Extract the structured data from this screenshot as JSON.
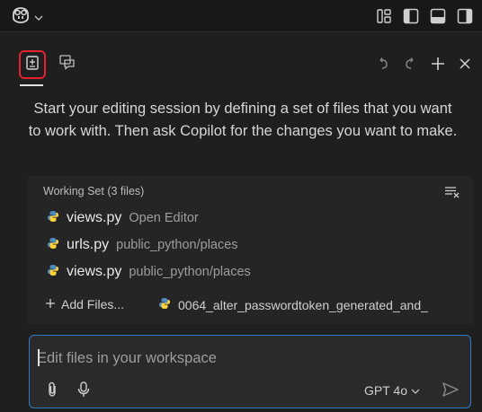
{
  "titlebar": {
    "logo_icon": "copilot-icon",
    "logo_menu_icon": "chevron-down-icon",
    "layout_icons": [
      "customize-layout-icon",
      "toggle-primary-sidebar-icon",
      "toggle-panel-icon",
      "toggle-secondary-sidebar-icon"
    ]
  },
  "toolbar": {
    "tabs": [
      {
        "icon": "copilot-edits-icon",
        "active": true
      },
      {
        "icon": "chat-icon",
        "active": false
      }
    ],
    "actions": [
      "undo-icon",
      "redo-icon",
      "new-session-icon",
      "close-icon"
    ]
  },
  "intro": {
    "text": "Start your editing session by defining a set of files that you want to work with. Then ask Copilot for the changes you want to make."
  },
  "working_set": {
    "title": "Working Set (3 files)",
    "clear_icon": "clear-all-icon",
    "files": [
      {
        "name": "views.py",
        "description": "Open Editor",
        "icon": "python-icon"
      },
      {
        "name": "urls.py",
        "description": "public_python/places",
        "icon": "python-icon"
      },
      {
        "name": "views.py",
        "description": "public_python/places",
        "icon": "python-icon"
      }
    ],
    "add_files_label": "Add Files...",
    "suggested_file": "0064_alter_passwordtoken_generated_and_"
  },
  "input": {
    "placeholder": "Edit files in your workspace",
    "value": "",
    "model_label": "GPT 4o",
    "attach_icon": "paperclip-icon",
    "mic_icon": "microphone-icon",
    "send_icon": "send-icon"
  },
  "colors": {
    "background": "#1f1f1f",
    "panel": "#252526",
    "focus_border": "#2f7acb",
    "highlight": "#e5212e",
    "python_blue": "#4b8bbe",
    "python_yellow": "#ffd43b"
  }
}
